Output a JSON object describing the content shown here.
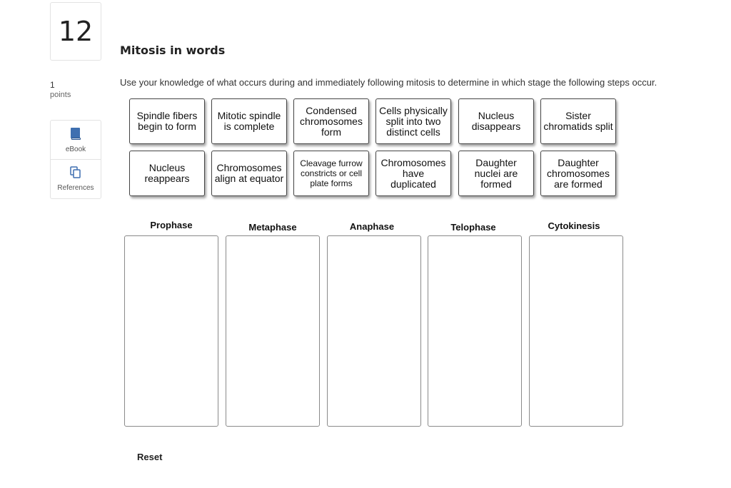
{
  "question": {
    "number": "12",
    "points_value": "1",
    "points_label": "points"
  },
  "tools": [
    {
      "label": "eBook",
      "icon": "book-icon"
    },
    {
      "label": "References",
      "icon": "copy-icon"
    }
  ],
  "title": "Mitosis in words",
  "instruction": "Use your knowledge of what occurs during and immediately following mitosis to determine in which stage the following steps occur.",
  "cards": [
    "Spindle fibers begin to form",
    "Mitotic spindle is complete",
    "Condensed chromosomes form",
    "Cells physically split into two distinct cells",
    "Nucleus disappears",
    "Sister chromatids split",
    "Nucleus reappears",
    "Chromosomes align at equator",
    "Cleavage furrow constricts or cell plate forms",
    "Chromosomes have duplicated",
    "Daughter nuclei are formed",
    "Daughter chromosomes are formed"
  ],
  "stages": [
    "Prophase",
    "Metaphase",
    "Anaphase",
    "Telophase",
    "Cytokinesis"
  ],
  "reset_label": "Reset"
}
